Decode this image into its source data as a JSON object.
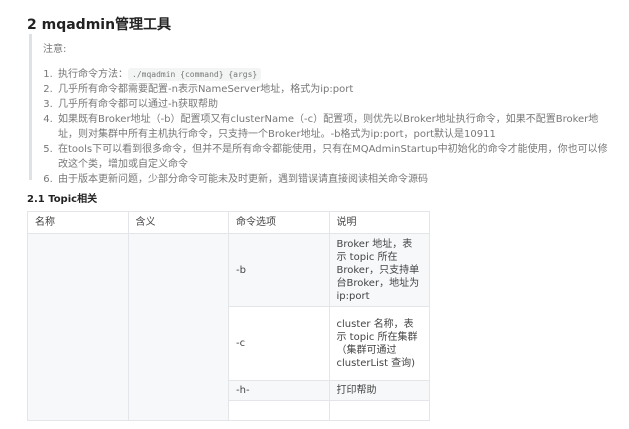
{
  "heading": "2 mqadmin管理工具",
  "note": "注意:",
  "items": [
    {
      "text": "执行命令方法：",
      "code": "./mqadmin {command} {args}"
    },
    {
      "text": "几乎所有命令都需要配置-n表示NameServer地址，格式为ip:port"
    },
    {
      "text": "几乎所有命令都可以通过-h获取帮助"
    },
    {
      "text": "如果既有Broker地址（-b）配置项又有clusterName（-c）配置项，则优先以Broker地址执行命令，如果不配置Broker地址，则对集群中所有主机执行命令，只支持一个Broker地址。-b格式为ip:port，port默认是10911"
    },
    {
      "text": "在tools下可以看到很多命令，但并不是所有命令都能使用，只有在MQAdminStartup中初始化的命令才能使用，你也可以修改这个类，增加或自定义命令"
    },
    {
      "text": "由于版本更新问题，少部分命令可能未及时更新，遇到错误请直接阅读相关命令源码"
    }
  ],
  "subheading": "2.1 Topic相关",
  "table": {
    "headers": [
      "名称",
      "含义",
      "命令选项",
      "说明"
    ],
    "rows": [
      {
        "option": "-b",
        "desc": "Broker 地址，表示 topic 所在 Broker，只支持单台Broker，地址为ip:port"
      },
      {
        "option": "-c",
        "desc": "cluster 名称，表示 topic 所在集群（集群可通过 clusterList 查询)"
      },
      {
        "option": "-h-",
        "desc": "打印帮助"
      }
    ]
  }
}
